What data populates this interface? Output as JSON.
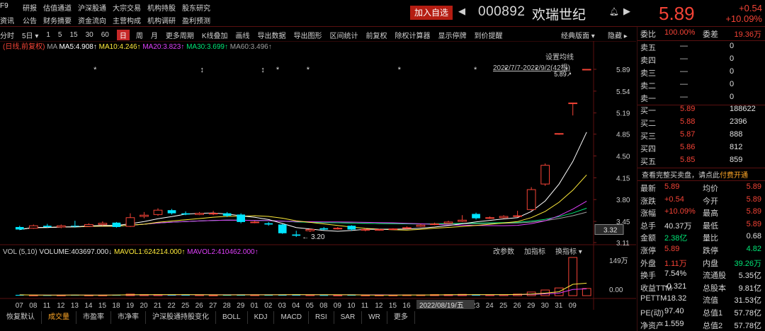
{
  "top_nav": {
    "row1": [
      "F9",
      "研报",
      "估值通道",
      "沪深股通",
      "大宗交易",
      "机构持股",
      "股东研究"
    ],
    "row2": [
      "资讯",
      "公告",
      "财务摘要",
      "资金流向",
      "主营构成",
      "机构调研",
      "盈利预测"
    ]
  },
  "title_bar": {
    "add_watch_label": "加入自选",
    "stock_code": "000892",
    "stock_name": "欢瑞世纪",
    "price": "5.89",
    "change": "+0.54",
    "change_pct": "+10.09%"
  },
  "toolbar": {
    "items": [
      "分时",
      "5日",
      "1",
      "5",
      "15",
      "30",
      "60"
    ],
    "selected": "日",
    "items2": [
      "周",
      "月",
      "更多周期",
      "K线叠加",
      "画线",
      "导出数据",
      "导出图形",
      "区间统计",
      "前复权",
      "除权计算器",
      "显示停牌",
      "到价提醒"
    ],
    "right_items": [
      "经典版面",
      "隐藏"
    ]
  },
  "chart": {
    "legend_mode": "(日线,前复权)",
    "ma_label": "MA",
    "ma5": "MA5:4.908↑",
    "ma10": "MA10:4.246↑",
    "ma20": "MA20:3.823↑",
    "ma30": "MA30:3.699↑",
    "ma60": "MA60:3.496↑",
    "settings_label": "设置均线",
    "range_label": "2022/7/7-2022/9/2(42根)",
    "high_label": "5.89↗",
    "low_label": "3.20",
    "current_price_tag": "3.32",
    "y_ticks": [
      "5.89",
      "5.54",
      "5.19",
      "4.85",
      "4.50",
      "4.15",
      "3.80",
      "3.45",
      "3.11"
    ],
    "volume_legend": {
      "vol": "VOL (5,10)",
      "volume": "VOLUME:403697.000↓",
      "mavol1": "MAVOL1:624214.000↑",
      "mavol2": "MAVOL2:410462.000↑"
    },
    "volume_actions": [
      "改参数",
      "加指标",
      "换指标"
    ],
    "volume_y_ticks": [
      "149万",
      "0.00"
    ],
    "x_ticks": [
      "07",
      "08",
      "11",
      "12",
      "13",
      "14",
      "15",
      "18",
      "19",
      "20",
      "21",
      "22",
      "25",
      "26",
      "27",
      "28",
      "29",
      "01",
      "02",
      "03",
      "04",
      "05",
      "08",
      "09",
      "10",
      "11",
      "12",
      "15",
      "16",
      "17",
      "18",
      "19",
      "22",
      "23",
      "24",
      "25",
      "26",
      "29",
      "30",
      "31",
      "09"
    ],
    "x_highlight": "2022/08/19/五",
    "colors": {
      "up": "#f44336",
      "down": "#00e5ff",
      "ma5": "#ffffff",
      "ma10": "#ffeb3b",
      "ma20": "#e040fb",
      "ma30": "#00e676",
      "ma60": "#9e9e9e"
    }
  },
  "chart_data": {
    "type": "candlestick",
    "candles": [
      {
        "o": 3.36,
        "c": 3.32,
        "h": 3.38,
        "l": 3.31
      },
      {
        "o": 3.34,
        "c": 3.38,
        "h": 3.4,
        "l": 3.33
      },
      {
        "o": 3.38,
        "c": 3.36,
        "h": 3.41,
        "l": 3.35
      },
      {
        "o": 3.36,
        "c": 3.38,
        "h": 3.4,
        "l": 3.34
      },
      {
        "o": 3.38,
        "c": 3.37,
        "h": 3.46,
        "l": 3.35
      },
      {
        "o": 3.37,
        "c": 3.4,
        "h": 3.42,
        "l": 3.36
      },
      {
        "o": 3.4,
        "c": 3.42,
        "h": 3.45,
        "l": 3.38
      },
      {
        "o": 3.43,
        "c": 3.36,
        "h": 3.44,
        "l": 3.35
      },
      {
        "o": 3.37,
        "c": 3.51,
        "h": 3.58,
        "l": 3.36
      },
      {
        "o": 3.53,
        "c": 3.55,
        "h": 3.6,
        "l": 3.5
      },
      {
        "o": 3.56,
        "c": 3.63,
        "h": 3.66,
        "l": 3.54
      },
      {
        "o": 3.63,
        "c": 3.58,
        "h": 3.65,
        "l": 3.56
      },
      {
        "o": 3.58,
        "c": 3.56,
        "h": 3.61,
        "l": 3.55
      },
      {
        "o": 3.56,
        "c": 3.58,
        "h": 3.6,
        "l": 3.55
      },
      {
        "o": 3.58,
        "c": 3.58,
        "h": 3.62,
        "l": 3.55
      },
      {
        "o": 3.58,
        "c": 3.54,
        "h": 3.6,
        "l": 3.52
      },
      {
        "o": 3.56,
        "c": 3.44,
        "h": 3.58,
        "l": 3.42
      },
      {
        "o": 3.44,
        "c": 3.44,
        "h": 3.46,
        "l": 3.42
      },
      {
        "o": 3.42,
        "c": 3.4,
        "h": 3.44,
        "l": 3.38
      },
      {
        "o": 3.4,
        "c": 3.26,
        "h": 3.41,
        "l": 3.25
      },
      {
        "o": 3.24,
        "c": 3.22,
        "h": 3.3,
        "l": 3.2
      },
      {
        "o": 3.3,
        "c": 3.32,
        "h": 3.34,
        "l": 3.28
      },
      {
        "o": 3.34,
        "c": 3.32,
        "h": 3.36,
        "l": 3.31
      },
      {
        "o": 3.33,
        "c": 3.34,
        "h": 3.36,
        "l": 3.32
      },
      {
        "o": 3.38,
        "c": 3.32,
        "h": 3.39,
        "l": 3.3
      },
      {
        "o": 3.31,
        "c": 3.32,
        "h": 3.34,
        "l": 3.29
      },
      {
        "o": 3.31,
        "c": 3.32,
        "h": 3.33,
        "l": 3.3
      },
      {
        "o": 3.32,
        "c": 3.33,
        "h": 3.34,
        "l": 3.31
      },
      {
        "o": 3.34,
        "c": 3.35,
        "h": 3.37,
        "l": 3.33
      },
      {
        "o": 3.37,
        "c": 3.39,
        "h": 3.41,
        "l": 3.36
      },
      {
        "o": 3.4,
        "c": 3.41,
        "h": 3.43,
        "l": 3.39
      },
      {
        "o": 3.42,
        "c": 3.44,
        "h": 3.46,
        "l": 3.41
      },
      {
        "o": 3.45,
        "c": 3.47,
        "h": 3.55,
        "l": 3.44
      },
      {
        "o": 3.57,
        "c": 3.5,
        "h": 3.59,
        "l": 3.48
      },
      {
        "o": 3.51,
        "c": 3.51,
        "h": 3.53,
        "l": 3.49
      },
      {
        "o": 3.51,
        "c": 3.53,
        "h": 3.55,
        "l": 3.5
      },
      {
        "o": 3.53,
        "c": 3.54,
        "h": 3.62,
        "l": 3.52
      },
      {
        "o": 3.64,
        "c": 3.96,
        "h": 4.0,
        "l": 3.62
      },
      {
        "o": 4.05,
        "c": 4.35,
        "h": 4.38,
        "l": 4.02
      },
      {
        "o": 4.85,
        "c": 4.86,
        "h": 4.86,
        "l": 4.84
      },
      {
        "o": 5.34,
        "c": 5.35,
        "h": 5.35,
        "l": 5.15
      },
      {
        "o": 5.89,
        "c": 5.89,
        "h": 5.89,
        "l": 5.89
      }
    ],
    "volume": [
      3,
      2,
      2,
      2,
      3,
      2,
      2,
      3,
      6,
      4,
      4,
      3,
      3,
      3,
      2,
      3,
      4,
      3,
      3,
      4,
      5,
      3,
      2,
      2,
      3,
      2,
      2,
      2,
      3,
      3,
      4,
      4,
      5,
      4,
      3,
      4,
      6,
      14,
      22,
      30,
      149,
      28
    ],
    "ylim": [
      3.11,
      5.89
    ]
  },
  "order_book": {
    "weibi_label": "委比",
    "weibi_value": "100.00%",
    "weicha_label": "委差",
    "weicha_value": "19.36万",
    "sells": [
      {
        "label": "卖五",
        "price": "—",
        "vol": "0"
      },
      {
        "label": "卖四",
        "price": "—",
        "vol": "0"
      },
      {
        "label": "卖三",
        "price": "—",
        "vol": "0"
      },
      {
        "label": "卖二",
        "price": "—",
        "vol": "0"
      },
      {
        "label": "卖一",
        "price": "—",
        "vol": "0"
      }
    ],
    "buys": [
      {
        "label": "买一",
        "price": "5.89",
        "vol": "188622"
      },
      {
        "label": "买二",
        "price": "5.88",
        "vol": "2396"
      },
      {
        "label": "买三",
        "price": "5.87",
        "vol": "888"
      },
      {
        "label": "买四",
        "price": "5.86",
        "vol": "812"
      },
      {
        "label": "买五",
        "price": "5.85",
        "vol": "859"
      }
    ],
    "promo_text": "查看完整买卖盘，请点此",
    "promo_link": "付费开通"
  },
  "quote": [
    {
      "l1": "最新",
      "v1": "5.89",
      "l2": "均价",
      "v2": "5.89"
    },
    {
      "l1": "涨跌",
      "v1": "+0.54",
      "l2": "今开",
      "v2": "5.89"
    },
    {
      "l1": "涨幅",
      "v1": "+10.09%",
      "l2": "最高",
      "v2": "5.89"
    },
    {
      "l1": "总手",
      "v1": "40.37万",
      "l2": "最低",
      "v2": "5.89"
    },
    {
      "l1": "金额",
      "v1": "2.38亿",
      "l2": "量比",
      "v2": "0.68"
    },
    {
      "l1": "涨停",
      "v1": "5.89",
      "l2": "跌停",
      "v2": "4.82"
    },
    {
      "l1": "外盘",
      "v1": "1.11万",
      "l2": "内盘",
      "v2": "39.26万"
    },
    {
      "l1": "换手",
      "v1": "7.54%",
      "l2": "流通股",
      "v2": "5.35亿"
    },
    {
      "l1": "收益TTM",
      "v1": "-0.321",
      "l2": "总股本",
      "v2": "9.81亿"
    },
    {
      "l1": "PETTM",
      "v1": "-18.32",
      "l2": "流值",
      "v2": "31.53亿"
    },
    {
      "l1": "PE(动)",
      "v1": "97.40",
      "l2": "总值1",
      "v2": "57.78亿"
    },
    {
      "l1": "净资产",
      "v1": "1.559",
      "l2": "总值2",
      "v2": "57.78亿"
    }
  ],
  "bottom_tabs": [
    "恢复默认",
    "成交量",
    "市盈率",
    "市净率",
    "沪深股通持股变化",
    "BOLL",
    "KDJ",
    "MACD",
    "RSI",
    "SAR",
    "WR",
    "更多"
  ],
  "bottom_active": "成交量"
}
